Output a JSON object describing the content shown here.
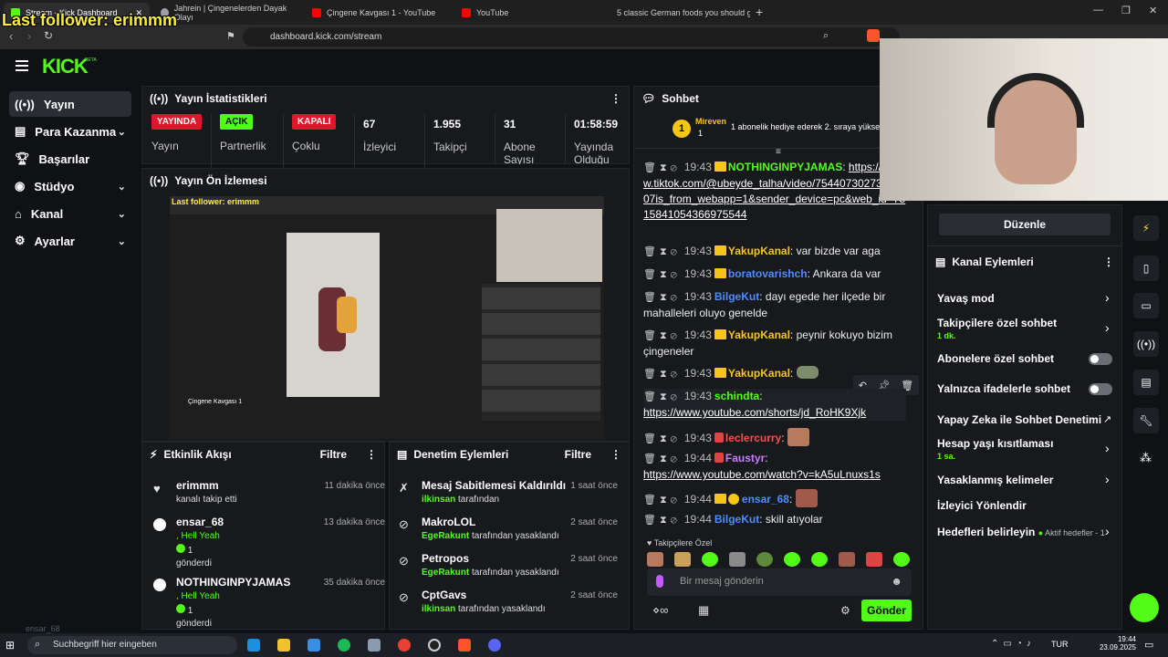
{
  "overlay": {
    "last_follower": "Last follower: erimmm"
  },
  "browser": {
    "tabs": [
      {
        "label": "Stream - Kick Dashboard",
        "color": "#53fc18"
      },
      {
        "label": "Jahrein | Çingenelerden Dayak Olayı",
        "color": "#9aa0a6"
      },
      {
        "label": "Çingene Kavgası 1 - YouTube",
        "color": "#ff0000"
      },
      {
        "label": "YouTube",
        "color": "#ff0000"
      },
      {
        "label": "5 classic German foods you should g",
        "color": "#ff0000"
      }
    ],
    "url": "dashboard.kick.com/stream"
  },
  "brand": {
    "logo": "KICK",
    "beta": "BETA"
  },
  "sidebar": {
    "items": [
      {
        "label": "Yayın",
        "icon": "broadcast-icon"
      },
      {
        "label": "Para Kazanma",
        "icon": "money-icon"
      },
      {
        "label": "Başarılar",
        "icon": "trophy-icon"
      },
      {
        "label": "Stüdyo",
        "icon": "studio-icon"
      },
      {
        "label": "Kanal",
        "icon": "channel-icon"
      },
      {
        "label": "Ayarlar",
        "icon": "gear-icon"
      }
    ]
  },
  "stats": {
    "title": "Yayın İstatistikleri",
    "badges": [
      {
        "badge": "YAYINDA",
        "label": "Yayın",
        "color": "#e0162b"
      },
      {
        "badge": "AÇIK",
        "label": "Partnerlik",
        "color": "#53fc18"
      },
      {
        "badge": "KAPALI",
        "label": "Çoklu",
        "color": "#e0162b"
      }
    ],
    "numbers": [
      {
        "value": "67",
        "label": "İzleyici"
      },
      {
        "value": "1.955",
        "label": "Takipçi"
      },
      {
        "value": "31",
        "label": "Abone Sayısı"
      },
      {
        "value": "01:58:59",
        "label": "Yayında Olduğu"
      }
    ]
  },
  "preview": {
    "title": "Yayın Ön İzlemesi",
    "inner_overlay": "Last follower: erimmm",
    "video_title": "Çingene Kavgası 1"
  },
  "activity": {
    "title": "Etkinlik Akışı",
    "filter": "Filtre",
    "items": [
      {
        "name": "erimmm",
        "sub": "kanalı takip etti",
        "time": "11 dakika önce"
      },
      {
        "name": "ensar_68",
        "sub": ", Hell Yeah",
        "count": "1",
        "extra": "gönderdi",
        "time": "13 dakika önce"
      },
      {
        "name": "NOTHINGINPYJAMAS",
        "sub": ", Hell Yeah",
        "count": "1",
        "extra": "gönderdi",
        "time": "35 dakika önce"
      }
    ]
  },
  "moderation": {
    "title": "Denetim Eylemleri",
    "filter": "Filtre",
    "items": [
      {
        "name": "Mesaj Sabitlemesi Kaldırıldı",
        "by": "ilkinsan",
        "suffix": "tarafından",
        "time": "1 saat önce"
      },
      {
        "name": "MakroLOL",
        "by": "EgeRakunt",
        "suffix": "tarafından yasaklandı",
        "time": "2 saat önce"
      },
      {
        "name": "Petropos",
        "by": "EgeRakunt",
        "suffix": "tarafından yasaklandı",
        "time": "2 saat önce"
      },
      {
        "name": "CptGavs",
        "by": "ilkinsan",
        "suffix": "tarafından yasaklandı",
        "time": "2 saat önce"
      }
    ]
  },
  "chat": {
    "title": "Sohbet",
    "pinned_user": "Mireven",
    "pinned_count": "1",
    "pinned_text": "1 abonelik hediye ederek 2. sıraya yükseldi",
    "messages": [
      {
        "time": "19:43",
        "user": "NOTHINGINPYJAMAS",
        "color": "#53fc18",
        "text": "https://www.tiktok.com/@ubeyde_talha/video/7544073027371707is_from_webapp=1&sender_device=pc&web_id=7515841054366975544",
        "link": true
      },
      {
        "time": "19:43",
        "user": "YakupKanal",
        "color": "#f5c518",
        "text": "var bizde var aga"
      },
      {
        "time": "19:43",
        "user": "boratovarishch",
        "color": "#4d8dff",
        "text": "Ankara da var"
      },
      {
        "time": "19:43",
        "user": "BilgeKut",
        "color": "#4d8dff",
        "text": "dayı egede her ilçede bir mahalleleri oluyo genelde"
      },
      {
        "time": "19:43",
        "user": "YakupKanal",
        "color": "#f5c518",
        "text": "peynir kokuyo bizim çingeneler"
      },
      {
        "time": "19:43",
        "user": "YakupKanal",
        "color": "#f5c518",
        "text": ""
      },
      {
        "time": "19:43",
        "user": "schindta",
        "color": "#53fc18",
        "text": "https://www.youtube.com/shorts/jd_RoHK9Xjk",
        "link": true
      },
      {
        "time": "19:43",
        "user": "leclercurry",
        "color": "#ff4d4d",
        "text": ""
      },
      {
        "time": "19:44",
        "user": "Faustyr",
        "color": "#c77dff",
        "text": "https://www.youtube.com/watch?v=kA5uLnuxs1s",
        "link": true
      },
      {
        "time": "19:44",
        "user": "ensar_68",
        "color": "#4d8dff",
        "text": ""
      },
      {
        "time": "19:44",
        "user": "BilgeKut",
        "color": "#4d8dff",
        "text": "skill atıyolar"
      }
    ],
    "emote_bar_label": "Takipçilere Özel",
    "input_placeholder": "Bir mesaj gönderin",
    "send": "Gönder"
  },
  "actions": {
    "edit": "Düzenle",
    "title": "Kanal Eylemleri",
    "items": [
      {
        "label": "Yavaş mod",
        "type": "chevron"
      },
      {
        "label": "Takipçilere özel sohbet",
        "sub": "1 dk.",
        "type": "chevron"
      },
      {
        "label": "Abonelere özel sohbet",
        "type": "toggle"
      },
      {
        "label": "Yalnızca ifadelerle sohbet",
        "type": "toggle"
      },
      {
        "label": "Yapay Zeka ile Sohbet Denetimi",
        "type": "external"
      },
      {
        "label": "Hesap yaşı kısıtlaması",
        "sub": "1 sa.",
        "type": "chevron"
      },
      {
        "label": "Yasaklanmış kelimeler",
        "type": "chevron"
      },
      {
        "label": "İzleyici Yönlendir",
        "type": "none"
      },
      {
        "label": "Hedefleri belirleyin",
        "badge": "Aktif hedefler - 1",
        "type": "chevron"
      }
    ]
  },
  "taskbar": {
    "search": "Suchbegriff hier eingeben",
    "lang": "TUR",
    "time": "19:44",
    "date": "23.09.2025",
    "ghost_user": "ensar_68"
  }
}
